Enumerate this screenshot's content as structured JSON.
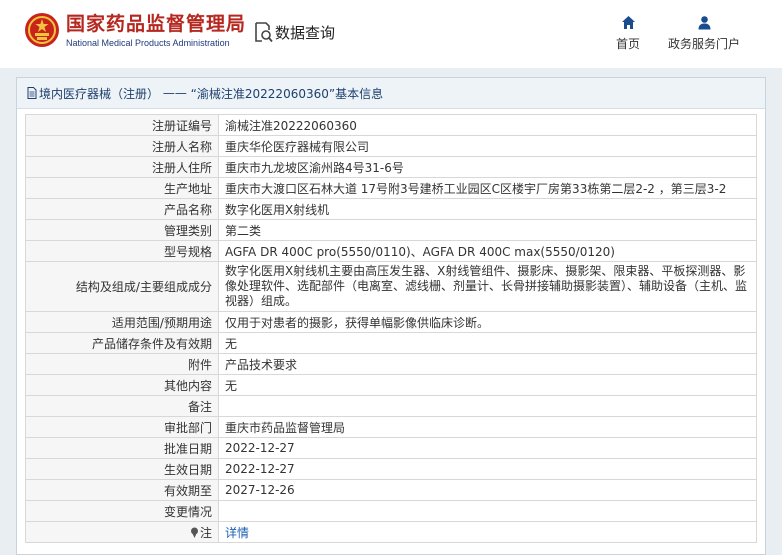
{
  "header": {
    "brand_cn": "国家药品监督管理局",
    "brand_en": "National Medical Products Administration",
    "query_label": "数据查询",
    "nav": [
      {
        "label": "首页",
        "icon": "home-icon"
      },
      {
        "label": "政务服务门户",
        "icon": "user-icon"
      }
    ]
  },
  "colors": {
    "brand_red": "#b6271f",
    "brand_blue": "#1f3a7a",
    "link_blue": "#1a5fb4"
  },
  "breadcrumb": {
    "section": "境内医疗器械（注册）",
    "separator": "——",
    "title": "“渝械注准20222060360”基本信息"
  },
  "table": {
    "rows": [
      {
        "label": "注册证编号",
        "value": "渝械注准20222060360"
      },
      {
        "label": "注册人名称",
        "value": "重庆华伦医疗器械有限公司"
      },
      {
        "label": "注册人住所",
        "value": "重庆市九龙坡区渝州路4号31-6号"
      },
      {
        "label": "生产地址",
        "value": "重庆市大渡口区石林大道 17号附3号建桥工业园区C区楼宇厂房第33栋第二层2-2 ，第三层3-2"
      },
      {
        "label": "产品名称",
        "value": "数字化医用X射线机"
      },
      {
        "label": "管理类别",
        "value": "第二类"
      },
      {
        "label": "型号规格",
        "value": "AGFA DR 400C pro(5550/0110)、AGFA DR 400C max(5550/0120)"
      },
      {
        "label": "结构及组成/主要组成成分",
        "value": "数字化医用X射线机主要由高压发生器、X射线管组件、摄影床、摄影架、限束器、平板探测器、影像处理软件、选配部件（电离室、滤线栅、剂量计、长骨拼接辅助摄影装置）、辅助设备（主机、监视器）组成。"
      },
      {
        "label": "适用范围/预期用途",
        "value": "仅用于对患者的摄影，获得单幅影像供临床诊断。"
      },
      {
        "label": "产品储存条件及有效期",
        "value": "无"
      },
      {
        "label": "附件",
        "value": "产品技术要求"
      },
      {
        "label": "其他内容",
        "value": "无"
      },
      {
        "label": "备注",
        "value": ""
      },
      {
        "label": "审批部门",
        "value": "重庆市药品监督管理局"
      },
      {
        "label": "批准日期",
        "value": "2022-12-27"
      },
      {
        "label": "生效日期",
        "value": "2022-12-27"
      },
      {
        "label": "有效期至",
        "value": "2027-12-26"
      },
      {
        "label": "变更情况",
        "value": ""
      }
    ],
    "note_label": "注",
    "note_link": "详情"
  }
}
